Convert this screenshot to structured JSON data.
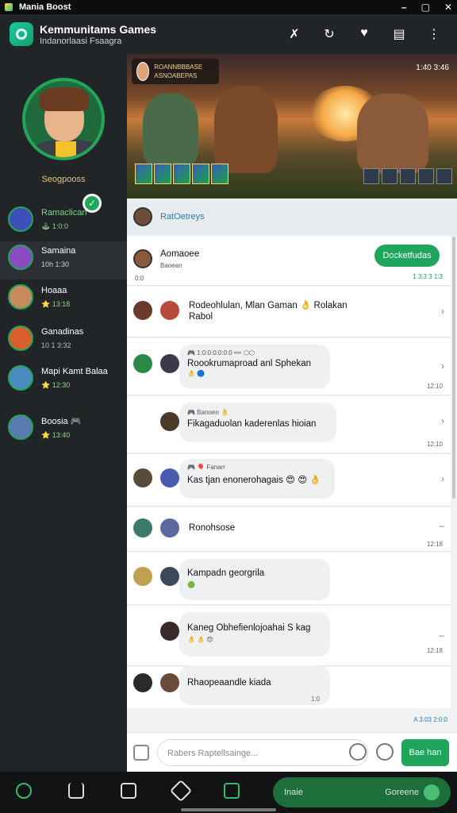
{
  "status": {
    "title": "Mania Boost",
    "controls": [
      "–",
      "▢",
      "✕"
    ]
  },
  "appbar": {
    "title": "Kemmunitams Games",
    "subtitle": "Indanorlaasi Fsaagra",
    "icons": [
      "share-icon",
      "refresh-icon",
      "heart-icon",
      "screen-icon",
      "more-icon"
    ]
  },
  "sidebar": {
    "profile_name": "Seogpooss",
    "friends": [
      {
        "name": "Ramaclican",
        "status": "🕹 1:0:0"
      },
      {
        "name": "Samaina",
        "status": "10h 1:30"
      },
      {
        "name": "Hoaaa",
        "status": "⭐ 13:18"
      },
      {
        "name": "Ganadinas",
        "status": "10 1 3:32"
      },
      {
        "name": "Mapi Kamt Balaa",
        "status": "⭐ 12:30"
      },
      {
        "name": "Boosia 🎮",
        "status": "⭐ 13:40"
      }
    ]
  },
  "hero": {
    "channel": "ROANNBBBASE ASNOABEPAS",
    "time": "1:40 3:46"
  },
  "chat": {
    "header_name": "RatOetreys",
    "pinned": {
      "name": "Aomaoee",
      "sub": "Baoean",
      "meta": "0:0",
      "button": "Docketfudas",
      "time": "1 3:3 3 1:3"
    },
    "messages": [
      {
        "text": "Rodeohlulan, Mlan Gaman 👌 Rolakan",
        "text2": "Rabol"
      },
      {
        "meta": "🎮 1:0:0:0:0:0:0 👓 ⬡⬡",
        "text": "Roookrumaproad anl Sphekan",
        "icons": "👌 🔵",
        "time": "12:10"
      },
      {
        "meta": "🎮 Banoen 👌",
        "text": "Fikagaduolan kaderenlas hioian",
        "time": "12:10"
      },
      {
        "meta": "🎮 🎈 Fanarr",
        "text": "Kas tjan enonerohagais 😍 😍 👌"
      },
      {
        "text": "Ronohsose",
        "time": "12:18"
      },
      {
        "text": "Kampadn georgrila",
        "icons": "🟢"
      },
      {
        "text": "Kaneg Obhefienlojoahai S kag",
        "icons": "👌 👌 😍",
        "time": "12:18"
      },
      {
        "text": "Rhaopeaandle kiada",
        "time": "1:0"
      }
    ],
    "footer_time": "A 3:03 2:0:0"
  },
  "input": {
    "placeholder": "Rabers Raptellsainge...",
    "send": "Bae han"
  },
  "bottom": {
    "pill_left": "Inaie",
    "pill_right": "Goreene"
  }
}
